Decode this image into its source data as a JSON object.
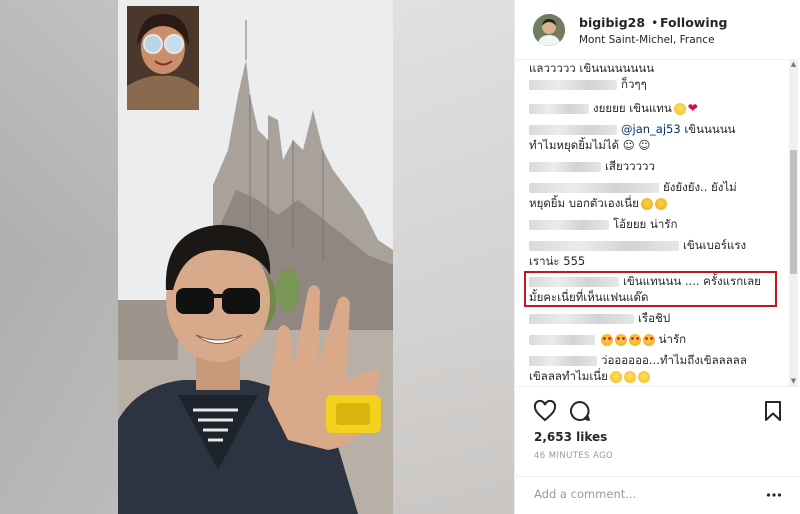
{
  "header": {
    "username": "bigibig28",
    "separator": "•",
    "follow_status": "Following",
    "location": "Mont Saint-Michel, France"
  },
  "comments": [
    {
      "text": "แลววววว เขินนนนนนนน"
    },
    {
      "text": "ก็วๆๆ"
    },
    {
      "text": "งยยยย เขินแทน"
    },
    {
      "mention": "@jan_aj53",
      "text": "เขินนนนน"
    },
    {
      "text": "ทำไมหยุดยิ้มไม่ได้ ☺ ☺"
    },
    {
      "text": "เสียววววว"
    },
    {
      "text": "ยังยังยัง.. ยังไม่"
    },
    {
      "text": "หยุดยิ้ม บอกตัวเองเนี่ย"
    },
    {
      "text": "โอ้ยยย น่ารัก"
    },
    {
      "text": "เขินเบอร์แรง"
    },
    {
      "text": "เราน่ะ 555"
    },
    {
      "text": "เขินแทนนน .... ครั้งแรกเลย"
    },
    {
      "text": "มั้ยคะเนี่ยที่เห็นแฟนแด๊ด"
    },
    {
      "text": "เรือชิป"
    },
    {
      "text": "น่ารัก"
    },
    {
      "text": "ว่ออออออ...ทำไมถึงเขิลลลลล"
    },
    {
      "text": "เขิลลลทำไมเนี่ย"
    }
  ],
  "actions": {
    "like_icon": "heart-icon",
    "comment_icon": "comment-bubble-icon",
    "save_icon": "bookmark-icon"
  },
  "likes": "2,653 likes",
  "timestamp": "46 MINUTES AGO",
  "add_comment": {
    "placeholder": "Add a comment...",
    "more_icon": "more-options-icon"
  },
  "colors": {
    "highlight": "#c4161c",
    "text": "#262626",
    "muted": "#999999",
    "mention": "#003569"
  }
}
